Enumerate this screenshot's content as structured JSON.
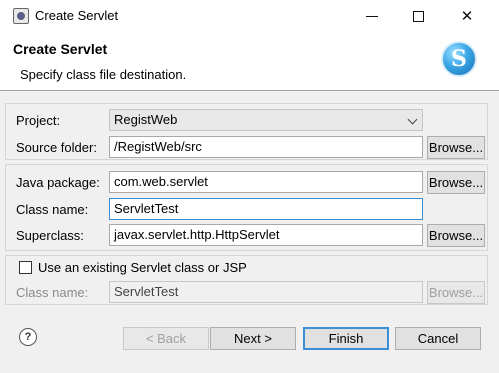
{
  "window": {
    "title": "Create Servlet",
    "close_glyph": "✕"
  },
  "header": {
    "title": "Create Servlet",
    "description": "Specify class file destination.",
    "logo_letter": "S"
  },
  "form": {
    "project": {
      "label": "Project:",
      "value": "RegistWeb"
    },
    "source_folder": {
      "label": "Source folder:",
      "value": "/RegistWeb/src",
      "browse": "Browse..."
    },
    "java_package": {
      "label": "Java package:",
      "value": "com.web.servlet",
      "browse": "Browse..."
    },
    "class_name": {
      "label": "Class name:",
      "value": "ServletTest"
    },
    "superclass": {
      "label": "Superclass:",
      "value": "javax.servlet.http.HttpServlet",
      "browse": "Browse..."
    },
    "existing": {
      "checkbox_label": "Use an existing Servlet class or JSP",
      "checked": false,
      "class_label": "Class name:",
      "class_value": "ServletTest",
      "browse": "Browse..."
    }
  },
  "footer": {
    "help_glyph": "?",
    "back": "< Back",
    "next": "Next >",
    "finish": "Finish",
    "cancel": "Cancel"
  }
}
